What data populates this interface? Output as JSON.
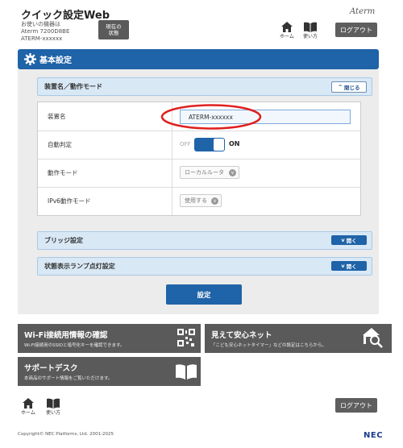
{
  "header": {
    "title": "クイック設定Web",
    "device_line1": "お使いの機器は",
    "device_line2": "Aterm 7200D8BE",
    "device_line3": "ATERM-xxxxxx",
    "status_button": "現在の\n状態",
    "logo": "Aterm",
    "home_label": "ホーム",
    "help_label": "使い方",
    "logout_label": "ログアウト"
  },
  "section": {
    "title": "基本設定"
  },
  "device_panel": {
    "title": "装置名／動作モード",
    "toggle_label": "閉じる",
    "rows": [
      {
        "label": "装置名",
        "value": "ATERM-xxxxxx"
      },
      {
        "label": "自動判定",
        "off_label": "OFF",
        "on_label": "ON"
      },
      {
        "label": "動作モード",
        "value": "ローカルルータ"
      },
      {
        "label": "IPv6動作モード",
        "value": "使用する"
      }
    ]
  },
  "bridge_panel": {
    "title": "ブリッジ設定",
    "toggle_label": "開く"
  },
  "lamp_panel": {
    "title": "状態表示ランプ点灯設定",
    "toggle_label": "開く"
  },
  "submit_label": "設定",
  "tiles": [
    {
      "title": "Wi-Fi接続用情報の確認",
      "desc": "Wi-Fi接続用のSSIDと暗号化キーを確認できます。"
    },
    {
      "title": "見えて安心ネット",
      "desc": "「こども安心ネットタイマー」などの設定はこちらから。"
    },
    {
      "title": "サポートデスク",
      "desc": "本商品のサポート情報をご覧いただけます。"
    }
  ],
  "footer": {
    "home_label": "ホーム",
    "help_label": "使い方",
    "logout_label": "ログアウト",
    "copyright": "Copyright© NEC Platforms, Ltd. 2001-2025",
    "brand": "NEC"
  },
  "colors": {
    "accent": "#1f63a8",
    "annotation": "#e02020"
  }
}
